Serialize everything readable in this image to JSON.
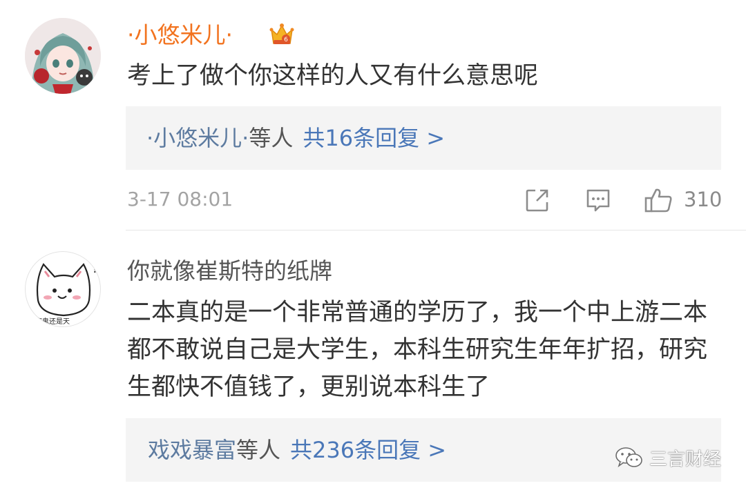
{
  "comments": [
    {
      "username": "·小悠米儿·",
      "vip_badge": "crown-vip-icon",
      "content": "考上了做个你这样的人又有什么意思呢",
      "replies": {
        "names": "·小悠米儿·",
        "etc": "等人",
        "count_text": "共16条回复 >"
      },
      "timestamp": "3-17 08:01",
      "like_count": "310"
    },
    {
      "username": "你就像崔斯特的纸牌",
      "avatar_caption": "魔鬼还是天",
      "content": "二本真的是一个非常普通的学历了，我一个中上游二本都不敢说自己是大学生，本科生研究生年年扩招，研究生都快不值钱了，更别说本科生了",
      "replies": {
        "names": "戏戏暴富",
        "etc": "等人",
        "count_text": "共236条回复 >"
      }
    }
  ],
  "watermark": {
    "text": "三言财经",
    "icon": "wechat-icon"
  },
  "colors": {
    "vip_name": "#f2731f",
    "link": "#4a77b8",
    "reply_bg": "#f4f4f4"
  }
}
